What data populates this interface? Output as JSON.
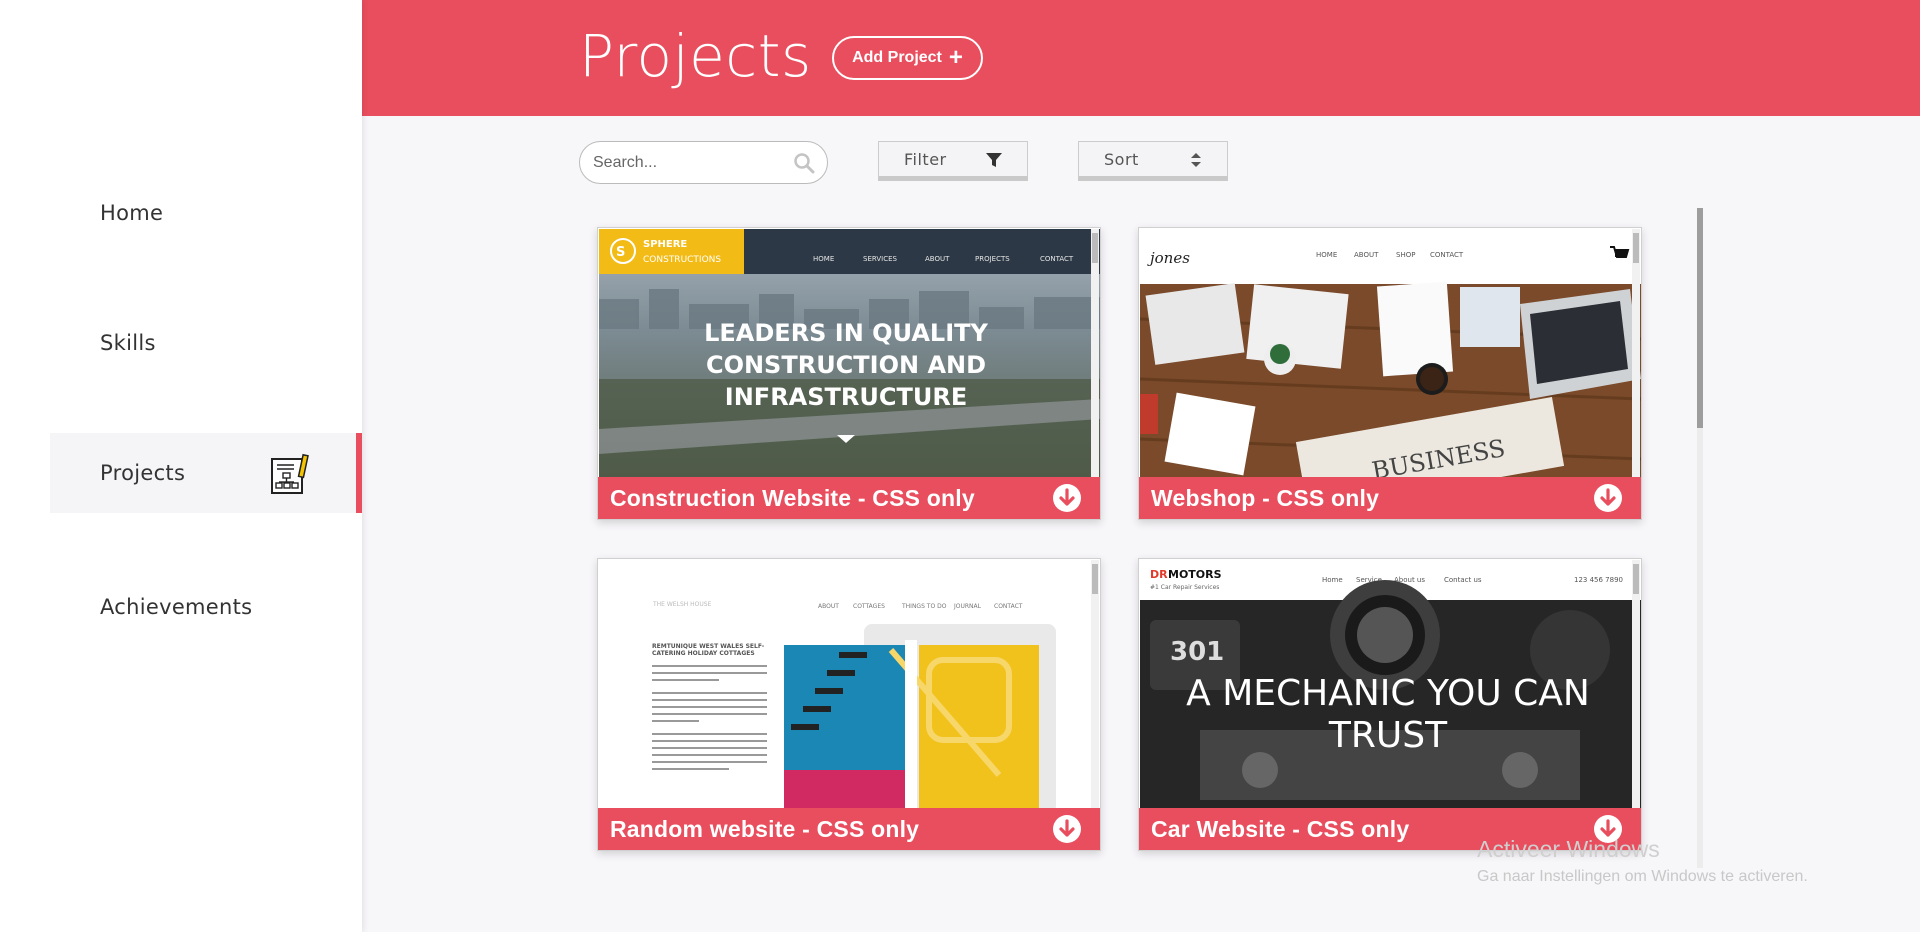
{
  "sidebar": {
    "items": [
      {
        "label": "Home"
      },
      {
        "label": "Skills"
      },
      {
        "label": "Projects",
        "active": true
      },
      {
        "label": "Achievements"
      }
    ]
  },
  "header": {
    "title": "Projects",
    "add_label": "Add Project",
    "add_icon": "plus-icon",
    "bg_color": "#e94e5e"
  },
  "toolbar": {
    "search_placeholder": "Search...",
    "filter_label": "Filter",
    "sort_label": "Sort"
  },
  "projects": [
    {
      "title": "Construction Website - CSS only",
      "preview": {
        "logo_line1": "SPHERE",
        "logo_line2": "CONSTRUCTIONS",
        "nav": [
          "HOME",
          "SERVICES",
          "ABOUT",
          "PROJECTS",
          "CONTACT"
        ],
        "hero_line1": "LEADERS IN QUALITY",
        "hero_line2": "CONSTRUCTION AND",
        "hero_line3": "INFRASTRUCTURE"
      }
    },
    {
      "title": "Webshop - CSS only",
      "preview": {
        "logo": "jones",
        "nav": [
          "HOME",
          "ABOUT",
          "SHOP",
          "CONTACT"
        ],
        "paper_text": "BUSINESS"
      }
    },
    {
      "title": "Random website - CSS only",
      "preview": {
        "logo": "THE WELSH HOUSE",
        "nav": [
          "ABOUT",
          "COTTAGES",
          "THINGS TO DO",
          "JOURNAL",
          "CONTACT"
        ],
        "heading_line1": "REMTUNIQUE WEST WALES SELF-",
        "heading_line2": "CATERING HOLIDAY COTTAGES"
      }
    },
    {
      "title": "Car Website - CSS only",
      "preview": {
        "logo_a": "DR",
        "logo_b": "MOTORS",
        "tagline": "#1 Car Repair Services",
        "nav": [
          "Home",
          "Service",
          "About us",
          "Contact us"
        ],
        "phone": "123 456 7890",
        "hero_line1": "A MECHANIC YOU CAN",
        "hero_line2": "TRUST",
        "plate": "301"
      }
    }
  ],
  "watermark": {
    "line1": "Activeer Windows",
    "line2": "Ga naar Instellingen om Windows te activeren."
  }
}
